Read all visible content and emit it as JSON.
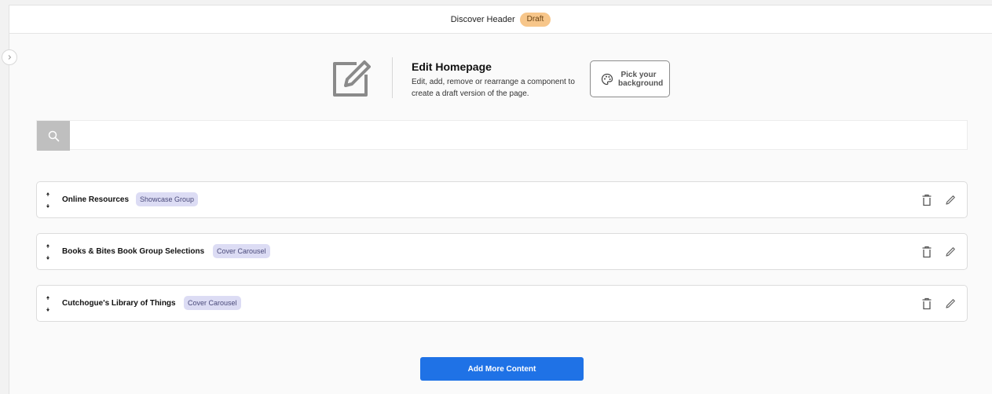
{
  "header": {
    "title": "Discover Header",
    "status_badge": "Draft"
  },
  "intro": {
    "heading": "Edit Homepage",
    "description": "Edit, add, remove or rearrange a component to create a draft version of the page.",
    "background_button_label": "Pick your background"
  },
  "search": {
    "value": "",
    "placeholder": ""
  },
  "components": [
    {
      "name": "Online Resources",
      "type": "Showcase Group"
    },
    {
      "name": "Books & Bites Book Group Selections",
      "type": "Cover Carousel"
    },
    {
      "name": "Cutchogue's Library of Things",
      "type": "Cover Carousel"
    }
  ],
  "add_button_label": "Add More Content",
  "icons": {
    "edit_page": "edit-square-icon",
    "palette": "palette-icon",
    "search": "search-icon",
    "reorder": "drag-arrows-icon",
    "delete": "trash-icon",
    "edit": "pencil-icon",
    "collapse": "chevron-right-icon"
  },
  "colors": {
    "draft_badge": "#f7c68a",
    "type_tag": "#dcdcf4",
    "primary_button": "#1f72e6"
  }
}
